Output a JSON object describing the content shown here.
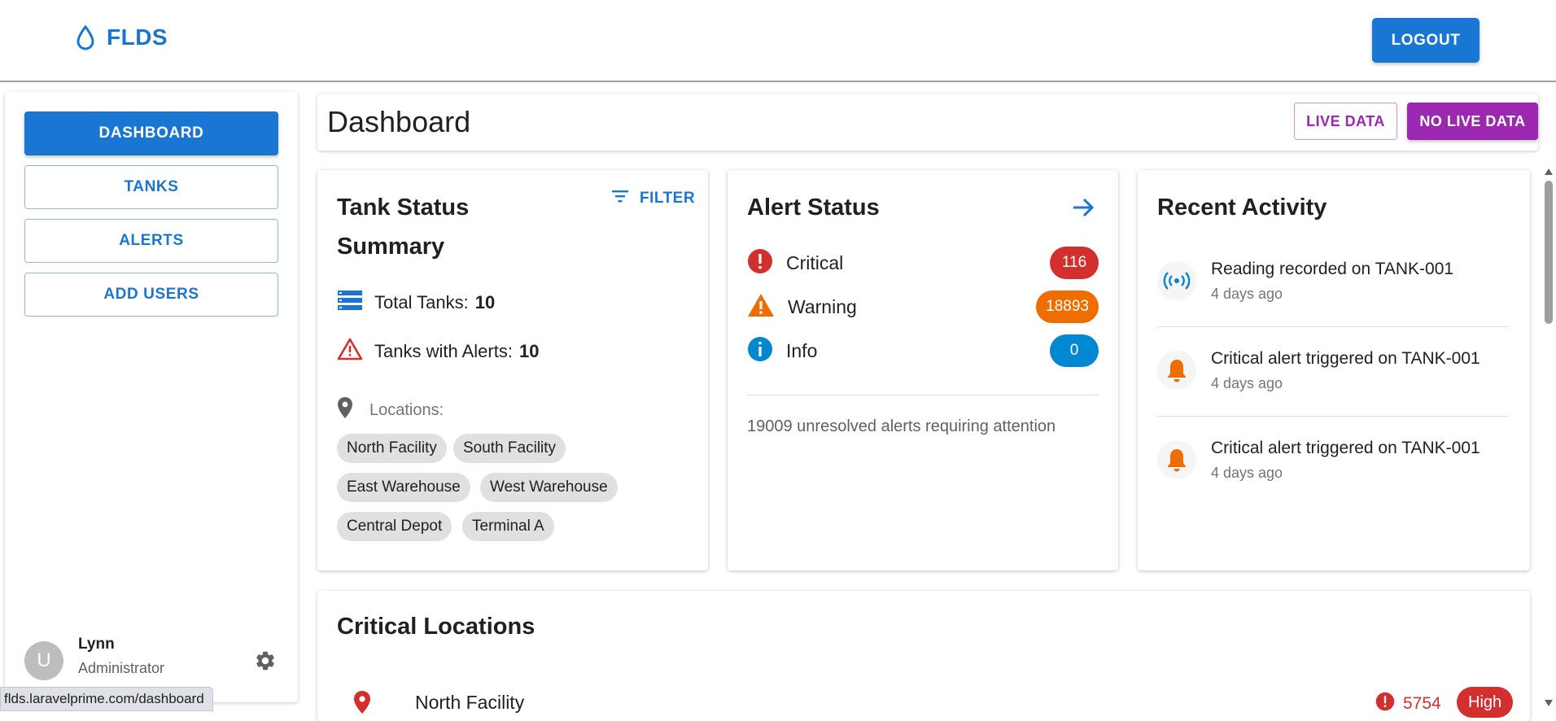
{
  "app": {
    "name": "FLDS",
    "logout_label": "LOGOUT"
  },
  "sidebar": {
    "items": [
      {
        "label": "DASHBOARD",
        "active": true
      },
      {
        "label": "TANKS",
        "active": false
      },
      {
        "label": "ALERTS",
        "active": false
      },
      {
        "label": "ADD USERS",
        "active": false
      }
    ],
    "user": {
      "avatar_letter": "U",
      "name": "Lynn",
      "role": "Administrator"
    }
  },
  "status_bar": {
    "url": "flds.laravelprime.com/dashboard"
  },
  "header": {
    "title": "Dashboard",
    "live_label": "LIVE DATA",
    "no_live_label": "NO LIVE DATA"
  },
  "tank_summary": {
    "title_line1": "Tank Status",
    "title_line2": "Summary",
    "filter_label": "FILTER",
    "total_label": "Total Tanks:",
    "total_value": "10",
    "alerts_label": "Tanks with Alerts:",
    "alerts_value": "10",
    "locations_label": "Locations:",
    "locations": [
      "North Facility",
      "South Facility",
      "East Warehouse",
      "West Warehouse",
      "Central Depot",
      "Terminal A"
    ]
  },
  "alert_status": {
    "title": "Alert Status",
    "rows": [
      {
        "label": "Critical",
        "count": "116",
        "color": "#d32f2f"
      },
      {
        "label": "Warning",
        "count": "18893",
        "color": "#ef6c00"
      },
      {
        "label": "Info",
        "count": "0",
        "color": "#0288d1"
      }
    ],
    "unresolved_text": "19009 unresolved alerts requiring attention"
  },
  "recent_activity": {
    "title": "Recent Activity",
    "items": [
      {
        "icon": "sensor-icon",
        "text": "Reading recorded on TANK-001",
        "time": "4 days ago"
      },
      {
        "icon": "bell-icon",
        "text": "Critical alert triggered on TANK-001",
        "time": "4 days ago"
      },
      {
        "icon": "bell-icon",
        "text": "Critical alert triggered on TANK-001",
        "time": "4 days ago"
      }
    ]
  },
  "critical_locations": {
    "title": "Critical Locations",
    "rows": [
      {
        "name": "North Facility",
        "count": "5754",
        "level": "High"
      }
    ]
  },
  "colors": {
    "primary": "#1976d2",
    "secondary": "#9c27b0",
    "critical": "#d32f2f",
    "warning": "#ef6c00",
    "info": "#0288d1"
  }
}
